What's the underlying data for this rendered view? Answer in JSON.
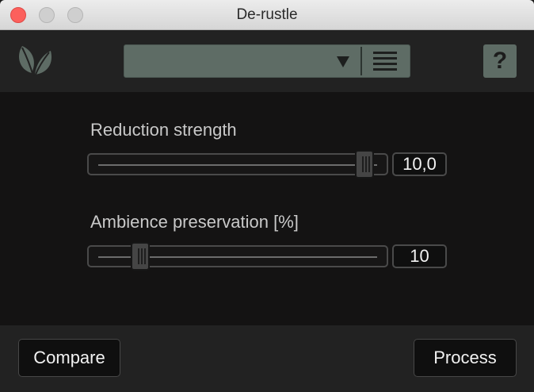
{
  "window": {
    "title": "De-rustle"
  },
  "header": {
    "logo_icon": "leaf-icon",
    "preset_selected": "",
    "preset_arrow_icon": "triangle-down-icon",
    "preset_menu_icon": "hamburger-menu-icon",
    "help_label": "?"
  },
  "controls": {
    "reduction": {
      "label": "Reduction strength",
      "value": "10,0",
      "fraction": 0.97
    },
    "ambience": {
      "label": "Ambience preservation [%]",
      "value": "10",
      "fraction": 0.1
    }
  },
  "footer": {
    "compare_label": "Compare",
    "process_label": "Process"
  },
  "colors": {
    "accent": "#5e6c65",
    "panel": "#222222",
    "body": "#141313"
  }
}
